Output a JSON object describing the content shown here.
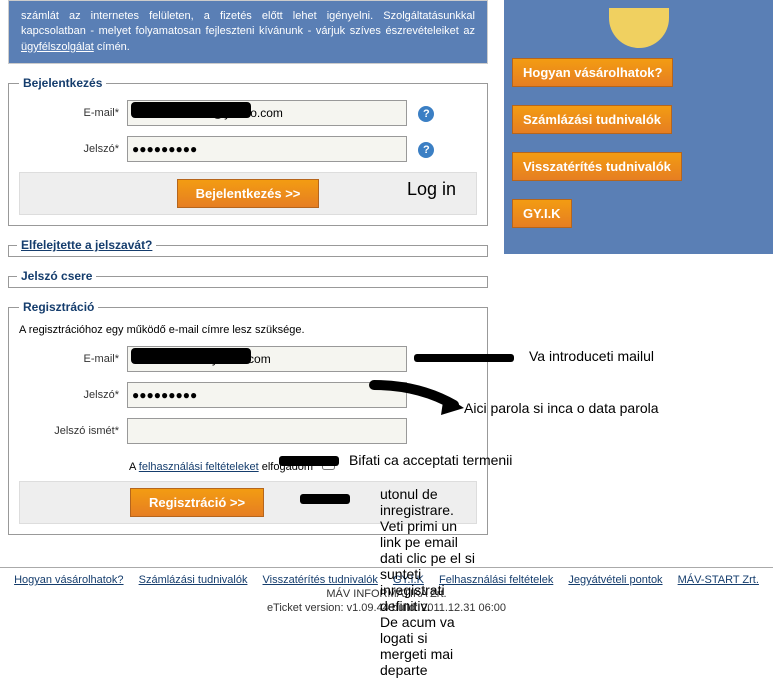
{
  "info_box": {
    "text_pre": "számlát az internetes felületen, a fizetés előtt lehet igényelni. Szolgáltatásunkkal kapcsolatban - melyet folyamatosan fejleszteni kívánunk - várjuk szíves észrevételeiket az ",
    "link": "ügyfélszolgálat",
    "text_post": " címén."
  },
  "login": {
    "legend": "Bejelentkezés",
    "email_label": "E-mail*",
    "email_value": "                        @yahoo.com",
    "password_label": "Jelszó*",
    "password_value": "●●●●●●●●●",
    "submit": "Bejelentkezés >>",
    "login_annot": "Log in"
  },
  "forgot": "Elfelejtette a jelszavát?",
  "pwchange": "Jelszó csere",
  "register": {
    "legend": "Regisztráció",
    "intro": "A regisztrációhoz egy működő e-mail címre lesz szüksége.",
    "email_label": "E-mail*",
    "email_value": "                        yahoo.com",
    "password_label": "Jelszó*",
    "password_value": "●●●●●●●●●",
    "password2_label": "Jelszó ismét*",
    "terms_pre": "A ",
    "terms_link": "felhasználási feltételeket",
    "terms_post": " elfogadom",
    "submit": "Regisztráció >>"
  },
  "side": {
    "btn1": "Hogyan vásárolhatok?",
    "btn2": "Számlázási tudnivalók",
    "btn3": "Visszatérítés tudnivalók",
    "btn4": "GY.I.K"
  },
  "annotations": {
    "email": "Va introduceti mailul",
    "password": "Aici parola si inca o data parola",
    "terms": "Bifati ca acceptati termenii",
    "reg1": "utonul de inregistrare. Veti primi un link pe email",
    "reg2": "dati clic pe el si sunteti inregistrati definitiv.",
    "reg3": "De acum va logati si mergeti mai departe"
  },
  "footer": {
    "links": [
      "Hogyan vásárolhatok?",
      "Számlázási tudnivalók",
      "Visszatérítés tudnivalók",
      "GY.I.K",
      "Felhasználási feltételek",
      "Jegyátvételi pontok",
      "MÁV-START Zrt."
    ],
    "company": "MÁV INFORMATIKA Zrt.",
    "version": "eTicket version: v1.09.44 build: 2011.12.31 06:00"
  }
}
